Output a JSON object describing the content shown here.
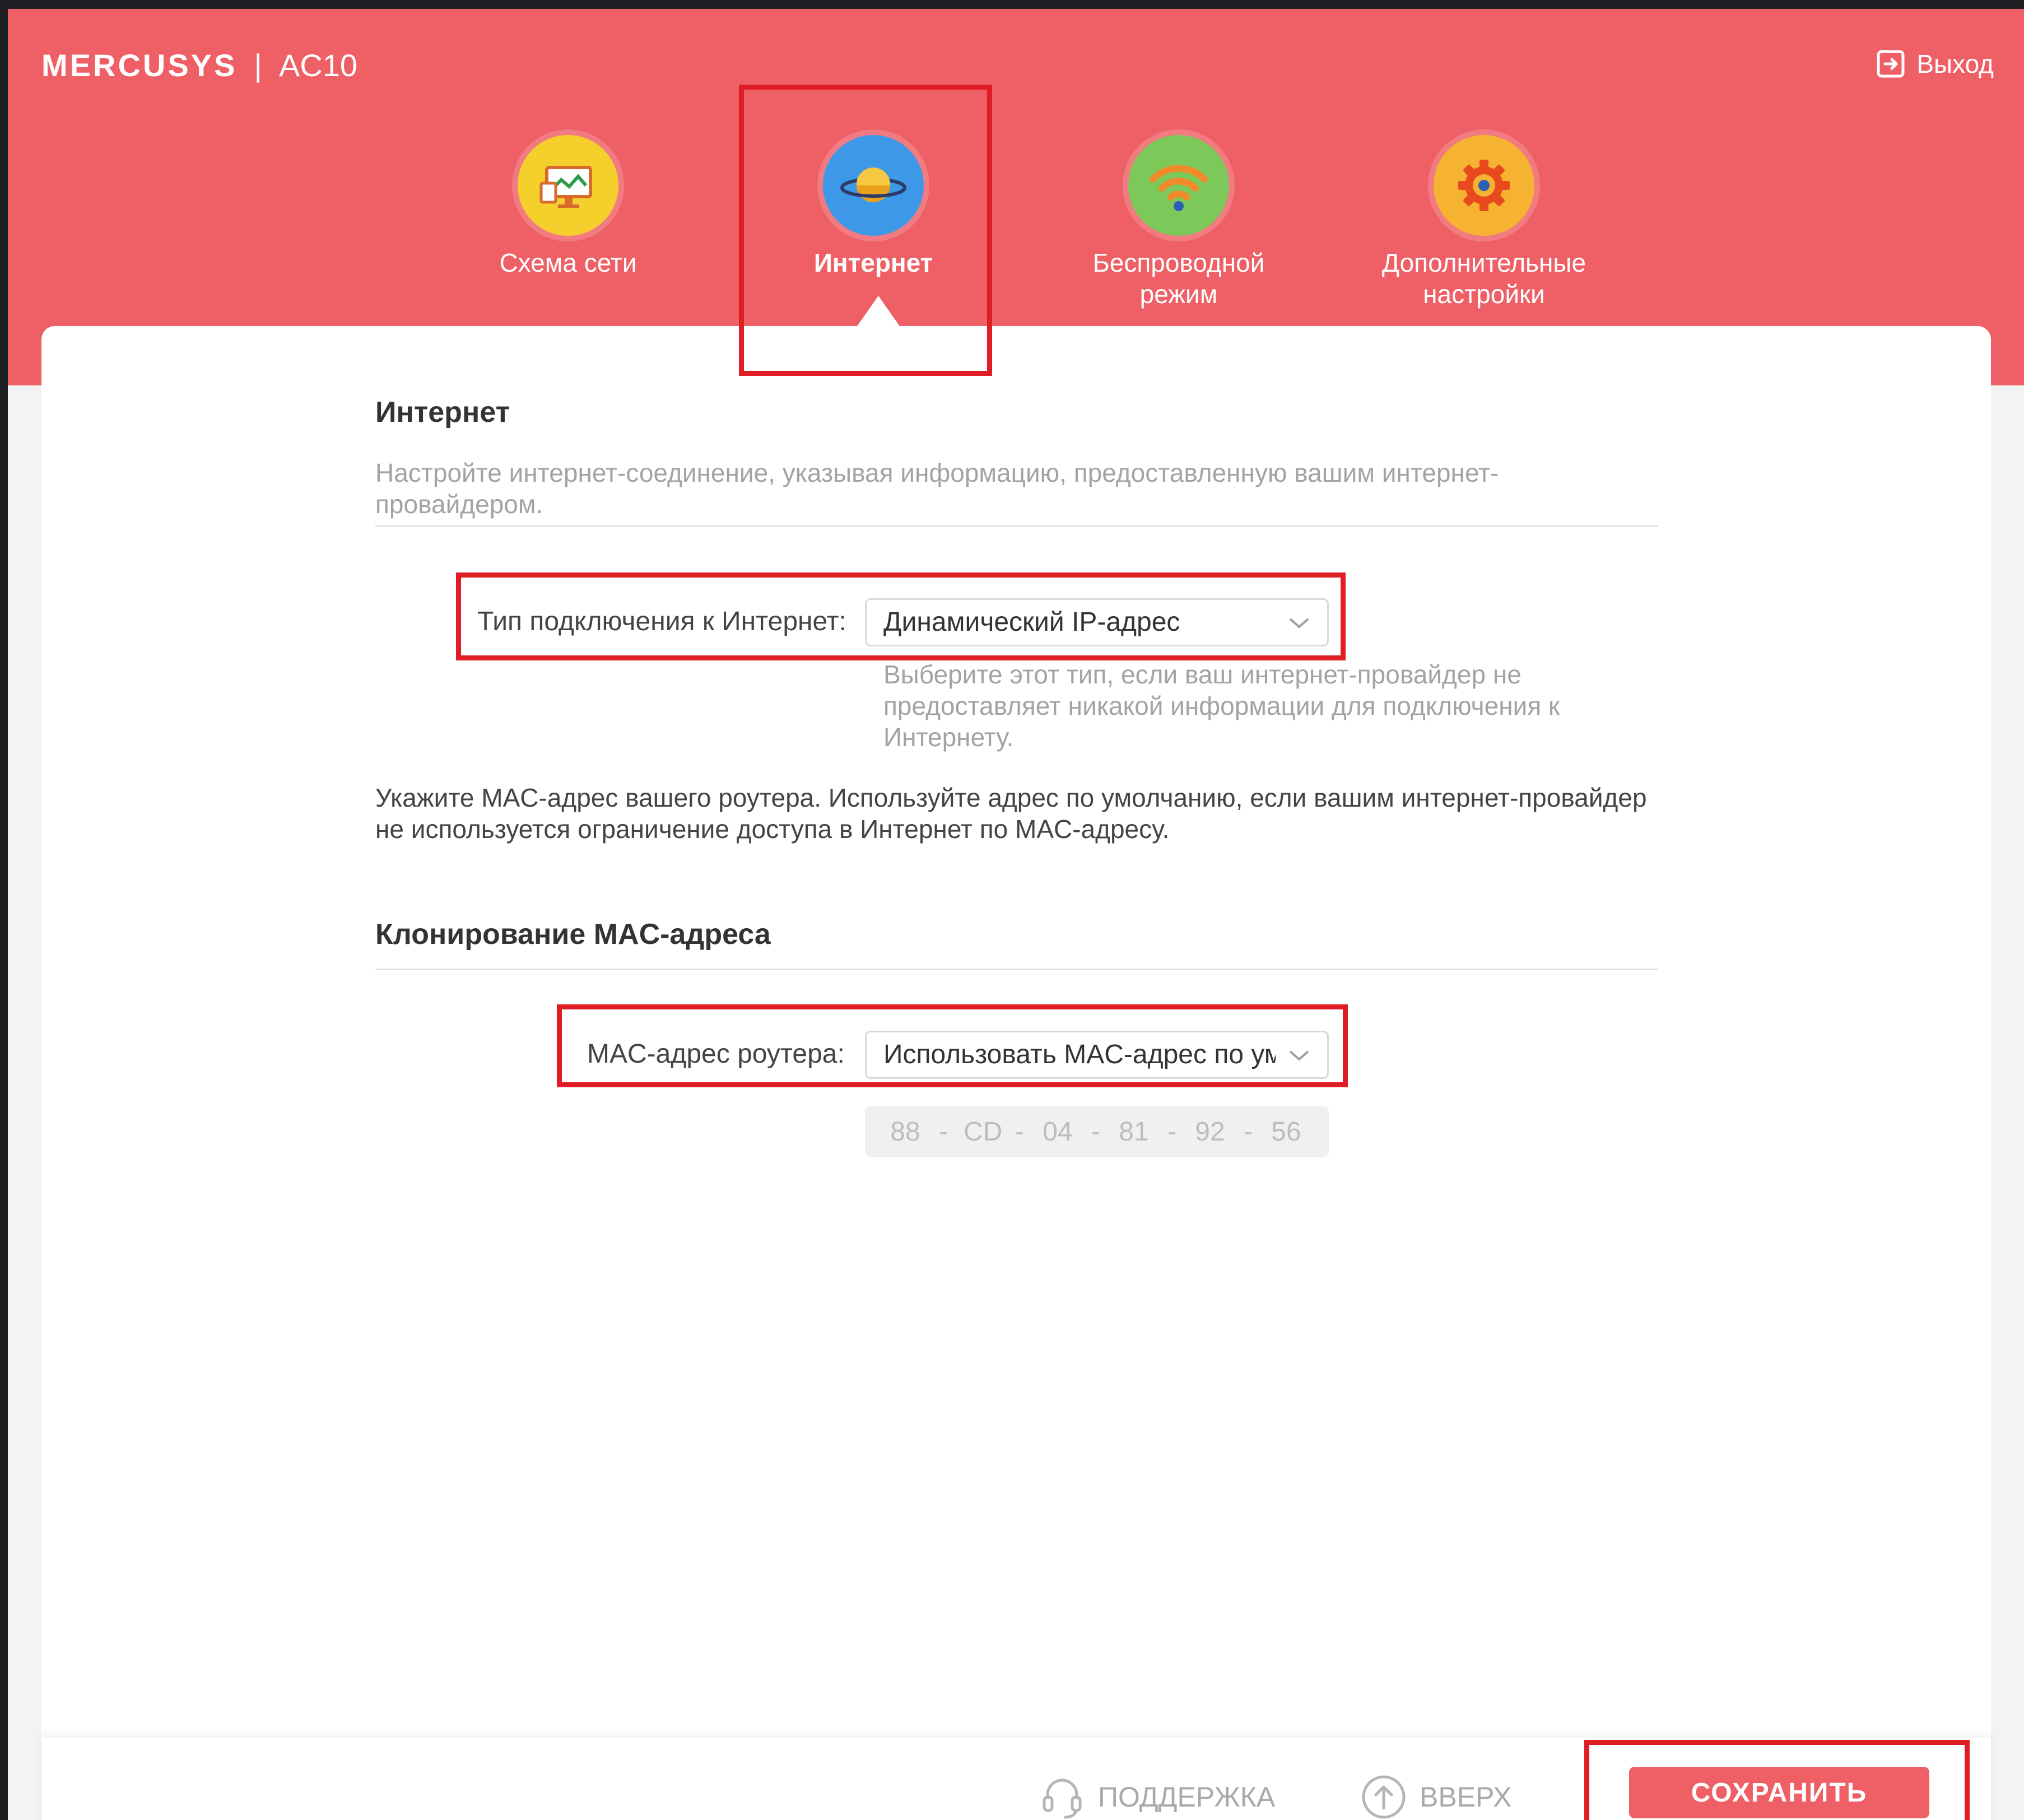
{
  "header": {
    "brand": "MERCUSYS",
    "separator": "|",
    "model": "AC10",
    "logout_label": "Выход"
  },
  "nav": [
    {
      "label": "Схема сети",
      "icon": "network-map-icon",
      "active": false
    },
    {
      "label": "Интернет",
      "icon": "planet-icon",
      "active": true
    },
    {
      "label": "Беспроводной режим",
      "icon": "wifi-icon",
      "active": false
    },
    {
      "label": "Дополнительные настройки",
      "icon": "gear-icon",
      "active": false
    }
  ],
  "internet": {
    "title": "Интернет",
    "description": "Настройте интернет-соединение, указывая информацию, предоставленную вашим интернет-провайдером.",
    "conn_type_label": "Тип подключения к Интернет:",
    "conn_type_value": "Динамический IP-адрес",
    "conn_type_hint": "Выберите этот тип, если ваш интернет-провайдер не предоставляет никакой информации для подключения к Интернету.",
    "mac_note": "Укажите MAC-адрес вашего роутера. Используйте адрес по умолчанию, если вашим интернет-провайдер не используется ограничение доступа в Интернет по MAC-адресу."
  },
  "mac_clone": {
    "title": "Клонирование MAC-адреса",
    "router_mac_label": "MAC-адрес роутера:",
    "router_mac_value": "Использовать MAC-адрес по ум",
    "mac_octets": [
      "88",
      "CD",
      "04",
      "81",
      "92",
      "56"
    ],
    "mac_separator": "-"
  },
  "footer": {
    "support_label": "ПОДДЕРЖКА",
    "top_label": "ВВЕРХ",
    "save_label": "СОХРАНИТЬ"
  },
  "colors": {
    "brand": "#ee5f66",
    "highlight_box": "#e01c24"
  }
}
